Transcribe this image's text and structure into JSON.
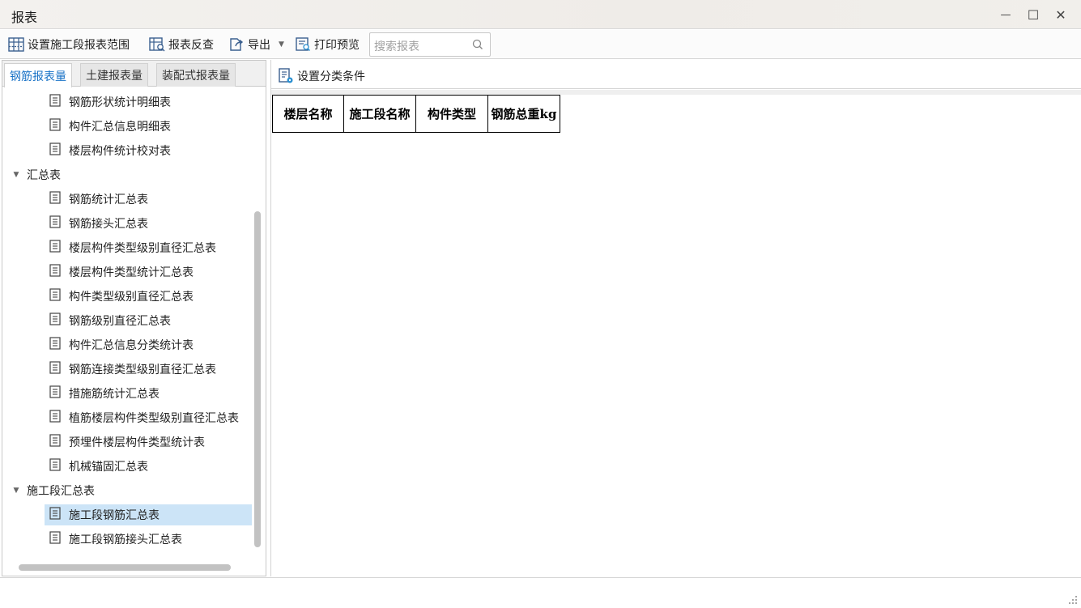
{
  "window": {
    "title": "报表",
    "minimize_glyph": "—",
    "maximize_glyph": "☐",
    "close_glyph": "✕"
  },
  "toolbar": {
    "set_range_label": "设置施工段报表范围",
    "reverse_check_label": "报表反查",
    "export_label": "导出",
    "print_preview_label": "打印预览",
    "search_placeholder": "搜索报表"
  },
  "tabs": [
    {
      "label": "钢筋报表量",
      "active": true
    },
    {
      "label": "土建报表量",
      "active": false
    },
    {
      "label": "装配式报表量",
      "active": false
    }
  ],
  "tree": {
    "items": [
      {
        "type": "leaf",
        "label": "钢筋形状统计明细表"
      },
      {
        "type": "leaf",
        "label": "构件汇总信息明细表"
      },
      {
        "type": "leaf",
        "label": "楼层构件统计校对表"
      },
      {
        "type": "group",
        "label": "汇总表",
        "expanded": true
      },
      {
        "type": "leaf",
        "label": "钢筋统计汇总表"
      },
      {
        "type": "leaf",
        "label": "钢筋接头汇总表"
      },
      {
        "type": "leaf",
        "label": "楼层构件类型级别直径汇总表"
      },
      {
        "type": "leaf",
        "label": "楼层构件类型统计汇总表"
      },
      {
        "type": "leaf",
        "label": "构件类型级别直径汇总表"
      },
      {
        "type": "leaf",
        "label": "钢筋级别直径汇总表"
      },
      {
        "type": "leaf",
        "label": "构件汇总信息分类统计表"
      },
      {
        "type": "leaf",
        "label": "钢筋连接类型级别直径汇总表"
      },
      {
        "type": "leaf",
        "label": "措施筋统计汇总表"
      },
      {
        "type": "leaf",
        "label": "植筋楼层构件类型级别直径汇总表"
      },
      {
        "type": "leaf",
        "label": "预埋件楼层构件类型统计表"
      },
      {
        "type": "leaf",
        "label": "机械锚固汇总表"
      },
      {
        "type": "group",
        "label": "施工段汇总表",
        "expanded": true
      },
      {
        "type": "leaf",
        "label": "施工段钢筋汇总表",
        "selected": true
      },
      {
        "type": "leaf",
        "label": "施工段钢筋接头汇总表"
      }
    ]
  },
  "right_panel": {
    "set_category_label": "设置分类条件"
  },
  "report_table": {
    "headers": [
      "楼层名称",
      "施工段名称",
      "构件类型",
      "钢筋总重kg"
    ]
  },
  "colors": {
    "accent": "#1a73c7",
    "selection": "#cce4f7"
  }
}
